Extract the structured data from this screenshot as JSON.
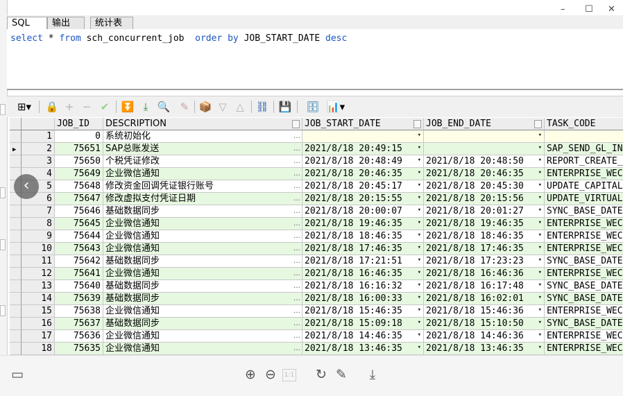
{
  "window": {
    "controls": [
      "–",
      "☐",
      "✕"
    ]
  },
  "tabs": [
    {
      "label": "SQL",
      "active": true
    },
    {
      "label": "输出",
      "active": false
    },
    {
      "label": "统计表",
      "active": false
    }
  ],
  "editor": {
    "kw_select": "select",
    "star": " * ",
    "kw_from": "from",
    "table": " sch_concurrent_job  ",
    "kw_order_by": "order by",
    "column": " JOB_START_DATE ",
    "kw_desc": "desc"
  },
  "toolbar": {
    "icons": [
      "grid-icon",
      "lock-icon",
      "add-icon",
      "remove-icon",
      "check-icon",
      "fetch-next-icon",
      "fetch-all-icon",
      "find-icon",
      "clear-icon",
      "export-icon",
      "filter-icon",
      "filter-up-icon",
      "query-tree-icon",
      "save-icon",
      "db-icon",
      "chart-icon"
    ]
  },
  "grid": {
    "columns": {
      "job_id": "JOB_ID",
      "description": "DESCRIPTION",
      "job_start_date": "JOB_START_DATE",
      "job_end_date": "JOB_END_DATE",
      "task_code": "TASK_CODE"
    },
    "ellipsis": "…",
    "dropdown": "▾",
    "rows": [
      {
        "n": "1",
        "id": "0",
        "desc": "系统初始化",
        "start": "",
        "end": "",
        "task": ""
      },
      {
        "n": "2",
        "id": "75651",
        "desc": "SAP总账发送",
        "start": "2021/8/18 20:49:15",
        "end": "",
        "task": "SAP_SEND_GL_INFO"
      },
      {
        "n": "3",
        "id": "75650",
        "desc": "个税凭证修改",
        "start": "2021/8/18 20:48:49",
        "end": "2021/8/18 20:48:50",
        "task": "REPORT_CREATE_TAX"
      },
      {
        "n": "4",
        "id": "75649",
        "desc": "企业微信通知",
        "start": "2021/8/18 20:46:35",
        "end": "2021/8/18 20:46:35",
        "task": "ENTERPRISE_WECHAT"
      },
      {
        "n": "5",
        "id": "75648",
        "desc": "修改资金回调凭证银行账号",
        "start": "2021/8/18 20:45:17",
        "end": "2021/8/18 20:45:30",
        "task": "UPDATE_CAPITAL"
      },
      {
        "n": "6",
        "id": "75647",
        "desc": "修改虚拟支付凭证日期",
        "start": "2021/8/18 20:15:55",
        "end": "2021/8/18 20:15:56",
        "task": "UPDATE_VIRTUAL"
      },
      {
        "n": "7",
        "id": "75646",
        "desc": "基础数据同步",
        "start": "2021/8/18 20:00:07",
        "end": "2021/8/18 20:01:27",
        "task": "SYNC_BASE_DATE"
      },
      {
        "n": "8",
        "id": "75645",
        "desc": "企业微信通知",
        "start": "2021/8/18 19:46:35",
        "end": "2021/8/18 19:46:35",
        "task": "ENTERPRISE_WECHAT"
      },
      {
        "n": "9",
        "id": "75644",
        "desc": "企业微信通知",
        "start": "2021/8/18 18:46:35",
        "end": "2021/8/18 18:46:35",
        "task": "ENTERPRISE_WECHAT"
      },
      {
        "n": "10",
        "id": "75643",
        "desc": "企业微信通知",
        "start": "2021/8/18 17:46:35",
        "end": "2021/8/18 17:46:35",
        "task": "ENTERPRISE_WECHAT"
      },
      {
        "n": "11",
        "id": "75642",
        "desc": "基础数据同步",
        "start": "2021/8/18 17:21:51",
        "end": "2021/8/18 17:23:23",
        "task": "SYNC_BASE_DATE"
      },
      {
        "n": "12",
        "id": "75641",
        "desc": "企业微信通知",
        "start": "2021/8/18 16:46:35",
        "end": "2021/8/18 16:46:36",
        "task": "ENTERPRISE_WECHAT"
      },
      {
        "n": "13",
        "id": "75640",
        "desc": "基础数据同步",
        "start": "2021/8/18 16:16:32",
        "end": "2021/8/18 16:17:48",
        "task": "SYNC_BASE_DATE"
      },
      {
        "n": "14",
        "id": "75639",
        "desc": "基础数据同步",
        "start": "2021/8/18 16:00:33",
        "end": "2021/8/18 16:02:01",
        "task": "SYNC_BASE_DATE"
      },
      {
        "n": "15",
        "id": "75638",
        "desc": "企业微信通知",
        "start": "2021/8/18 15:46:35",
        "end": "2021/8/18 15:46:36",
        "task": "ENTERPRISE_WECHAT"
      },
      {
        "n": "16",
        "id": "75637",
        "desc": "基础数据同步",
        "start": "2021/8/18 15:09:18",
        "end": "2021/8/18 15:10:50",
        "task": "SYNC_BASE_DATE"
      },
      {
        "n": "17",
        "id": "75636",
        "desc": "企业微信通知",
        "start": "2021/8/18 14:46:35",
        "end": "2021/8/18 14:46:36",
        "task": "ENTERPRISE_WECHAT"
      },
      {
        "n": "18",
        "id": "75635",
        "desc": "企业微信通知",
        "start": "2021/8/18 13:46:35",
        "end": "2021/8/18 13:46:35",
        "task": "ENTERPRISE_WECHAT"
      }
    ]
  },
  "viewer": {
    "nav_prev": "‹",
    "icons": [
      "thumbnail-icon",
      "zoom-in-icon",
      "zoom-out-icon",
      "actual-size-icon",
      "rotate-icon",
      "edit-icon",
      "download-icon"
    ],
    "actual_size_label": "1:1"
  }
}
